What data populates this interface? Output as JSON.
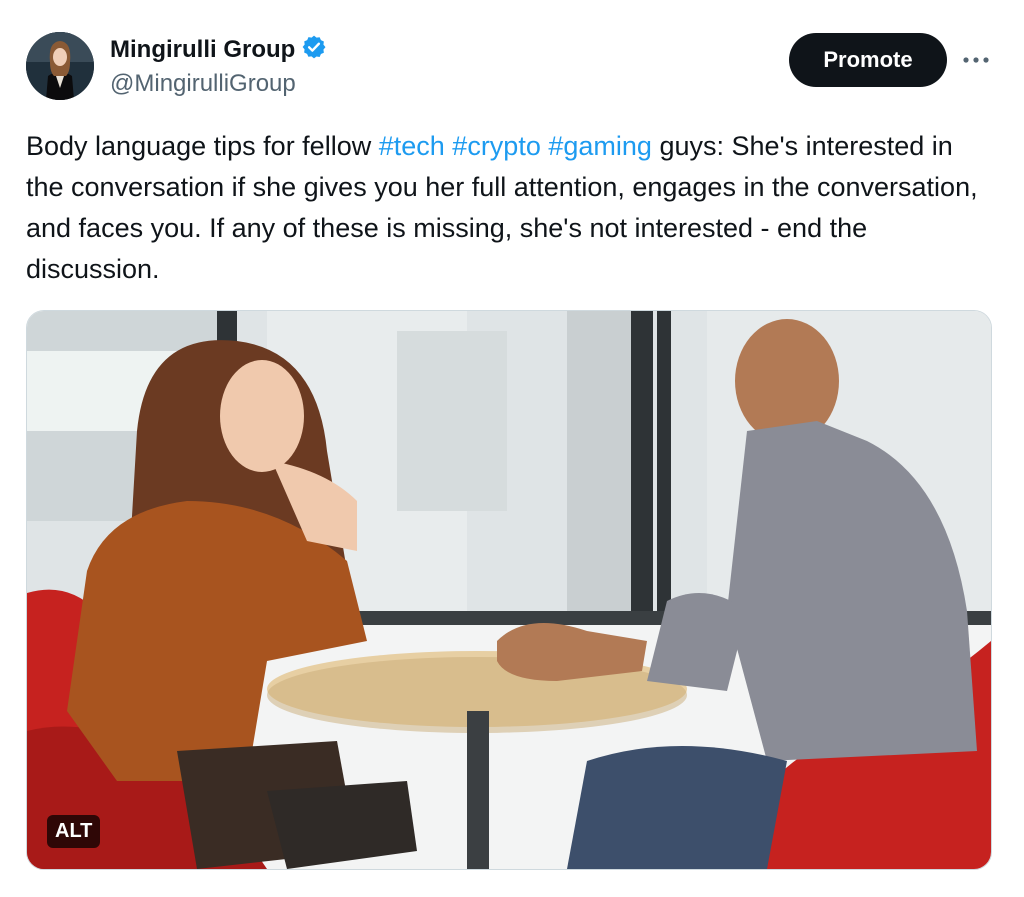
{
  "author": {
    "display_name": "Mingirulli Group",
    "handle": "@MingirulliGroup",
    "verified_icon": "verified-badge-icon",
    "avatar_icon": "profile-photo"
  },
  "actions": {
    "promote_label": "Promote",
    "more_icon": "more-options-icon"
  },
  "tweet": {
    "segment_1": "Body language tips for fellow ",
    "hashtag_1": "#tech",
    "space_1": " ",
    "hashtag_2": "#crypto",
    "space_2": " ",
    "hashtag_3": "#gaming",
    "segment_2": " guys: She's interested in the conversation if she gives you her full attention, engages in the conversation, and faces you. If any of these is missing, she's not interested - end the discussion."
  },
  "media": {
    "alt_label": "ALT"
  },
  "colors": {
    "text": "#0f1419",
    "secondary": "#536471",
    "link": "#1d9bf0",
    "verified": "#1d9bf0",
    "button_bg": "#0f1419"
  }
}
